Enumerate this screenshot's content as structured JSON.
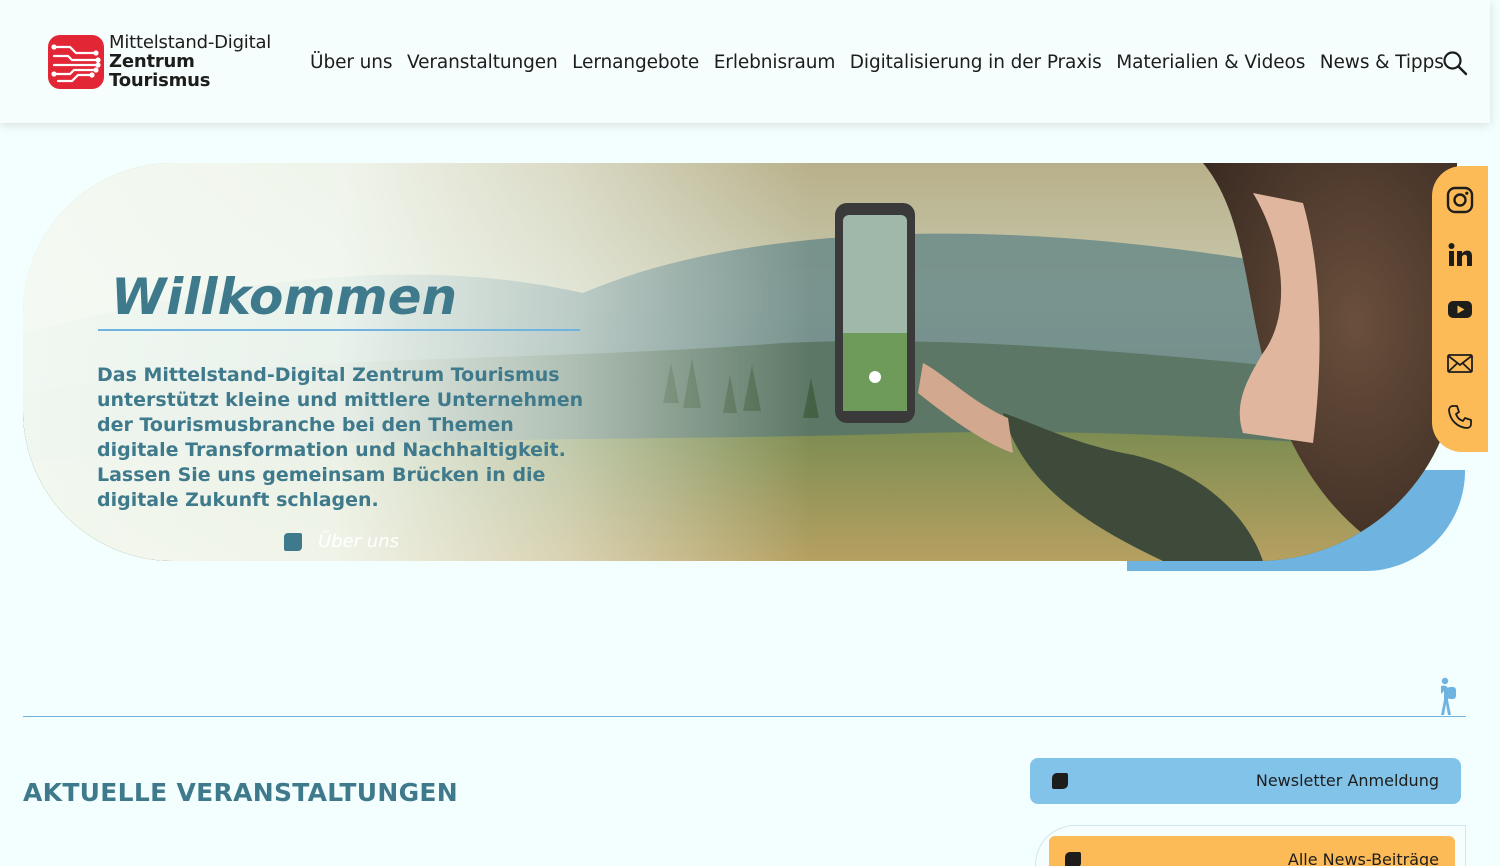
{
  "logo": {
    "line1": "Mittelstand-Digital",
    "line2": "Zentrum",
    "line3": "Tourismus",
    "icon": "circuit-logo-icon",
    "color": "#e32636"
  },
  "nav": {
    "items": [
      {
        "label": "Über uns"
      },
      {
        "label": "Veranstaltungen"
      },
      {
        "label": "Lernangebote"
      },
      {
        "label": "Erlebnisraum"
      },
      {
        "label": "Digitalisierung in der Praxis"
      },
      {
        "label": "Materialien & Videos"
      },
      {
        "label": "News & Tipps"
      }
    ],
    "search_icon": "search-icon"
  },
  "hero": {
    "title": "Willkommen",
    "text": "Das Mittelstand-Digital Zentrum Tourismus unterstützt kleine und mittlere Unternehmen der Tourismusbranche bei den Themen digitale Transformation und Nachhaltigkeit. Lassen Sie uns gemeinsam Brücken in die digitale Zukunft schlagen.",
    "link_label": "Über uns"
  },
  "social": {
    "icons": [
      "instagram-icon",
      "linkedin-icon",
      "youtube-icon",
      "mail-icon",
      "phone-icon"
    ],
    "color": "#fdbb58"
  },
  "section": {
    "title": "AKTUELLE VERANSTALTUNGEN"
  },
  "newsletter": {
    "label": "Newsletter Anmeldung",
    "color": "#82c3ea"
  },
  "news": {
    "label": "Alle News-Beiträge",
    "color": "#fdbb58"
  },
  "colors": {
    "primary_text": "#3f7a8c",
    "accent_blue": "#6fb3e0",
    "background": "#f3fefe"
  }
}
